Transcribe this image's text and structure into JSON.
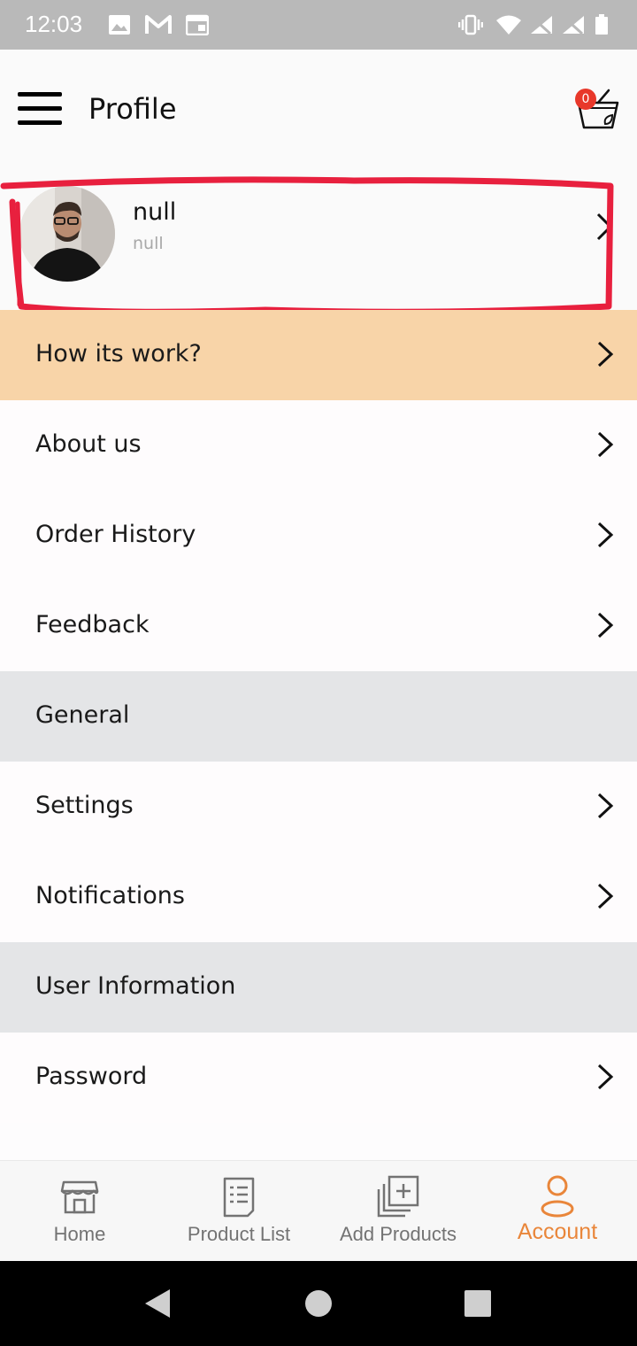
{
  "status_bar": {
    "time": "12:03",
    "left_icons": [
      "image-icon",
      "gmail-icon",
      "calendar-icon"
    ],
    "right_icons": [
      "vibrate-icon",
      "wifi-icon",
      "no-signal-icon",
      "no-signal-icon",
      "battery-icon"
    ]
  },
  "header": {
    "title": "Profile",
    "cart_count": "0"
  },
  "profile": {
    "name": "null",
    "subtitle": "null"
  },
  "menu": {
    "how_it_works": "How its work?",
    "about_us": "About us",
    "order_history": "Order History",
    "feedback": "Feedback",
    "section_general": "General",
    "settings": "Settings",
    "notifications": "Notifications",
    "section_user_info": "User Information",
    "password": "Password"
  },
  "bottom_nav": {
    "items": [
      {
        "label": "Home",
        "icon": "store-icon"
      },
      {
        "label": "Product List",
        "icon": "list-icon"
      },
      {
        "label": "Add Products",
        "icon": "add-box-icon"
      },
      {
        "label": "Account",
        "icon": "person-icon",
        "active": true
      }
    ]
  },
  "colors": {
    "accent": "#e9863a",
    "highlight_row": "#f8d4a8",
    "section_bg": "#e4e5e7",
    "annotation_red": "#e8203e",
    "badge": "#e8382a"
  }
}
